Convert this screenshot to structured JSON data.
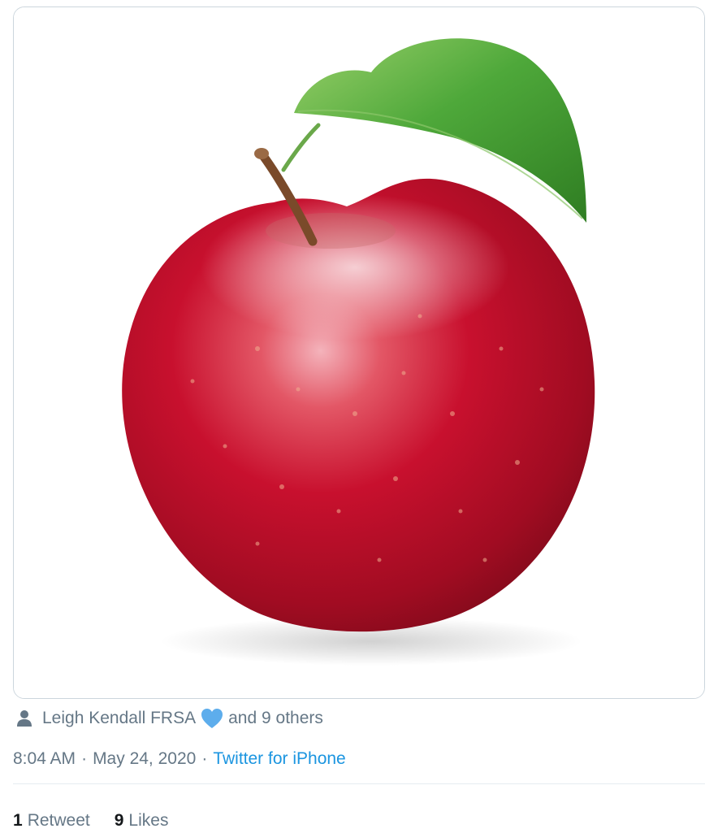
{
  "tweet": {
    "media": {
      "alt": "red-apple-photo",
      "colors": {
        "apple_red": "#c8102e",
        "leaf_green": "#3a9a2a",
        "stem_brown": "#7a4a2a"
      }
    },
    "tagged": {
      "icon": "person-icon",
      "name": "Leigh Kendall FRSA",
      "emoji": "blue-heart-icon",
      "others": "and 9 others"
    },
    "meta": {
      "time": "8:04 AM",
      "separator": "·",
      "date": "May 24, 2020",
      "source": "Twitter for iPhone"
    },
    "stats": {
      "retweets_count": "1",
      "retweets_label": "Retweet",
      "likes_count": "9",
      "likes_label": "Likes"
    }
  }
}
